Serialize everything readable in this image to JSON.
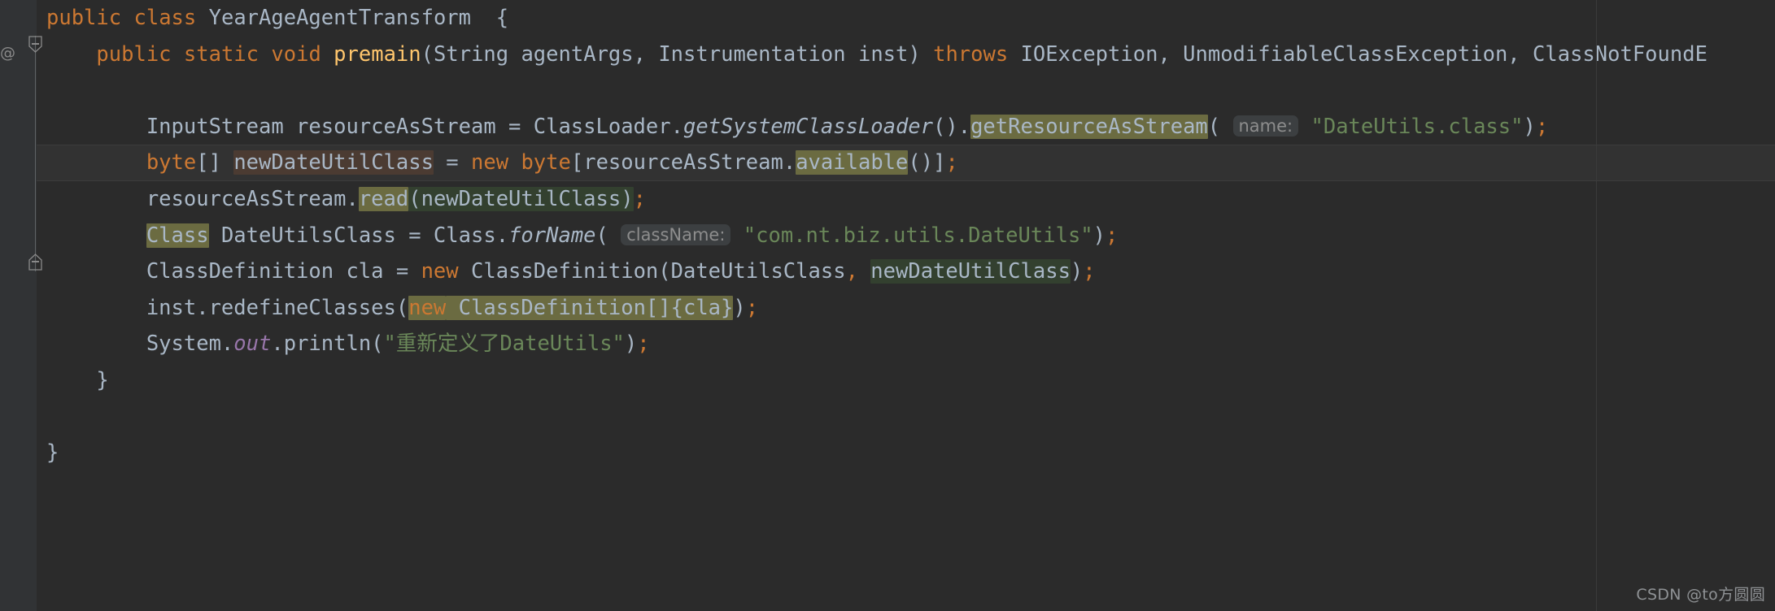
{
  "editor": {
    "background": "#2b2b2b",
    "gutter_background": "#313335",
    "caret_line_background": "#323232",
    "foreground": "#a9b7c6",
    "keyword_color": "#cc7832",
    "string_color": "#6a8759",
    "method_color": "#ffc66d",
    "static_field_color": "#9876aa",
    "highlight_olive": "#6b6b41",
    "highlight_green": "#33402f",
    "highlight_brown": "#4b3b32",
    "hint_background": "#3c3f41",
    "hint_color": "#8d8d8d"
  },
  "gutter": {
    "annotation_glyph": "@",
    "fold_open_icon": "fold-open-icon",
    "fold_close_icon": "fold-close-icon",
    "fold_minus_glyph": "−"
  },
  "code": {
    "language": "Java",
    "class_name": "YearAgeAgentTransform",
    "method_name": "premain",
    "lines": [
      {
        "id": "line-class-decl",
        "tokens": [
          {
            "t": "public",
            "k": "kw"
          },
          {
            "t": " ",
            "k": "plain"
          },
          {
            "t": "class",
            "k": "kw"
          },
          {
            "t": " ",
            "k": "plain"
          },
          {
            "t": "YearAgeAgentTransform",
            "k": "type"
          },
          {
            "t": "  {",
            "k": "plain"
          }
        ]
      },
      {
        "id": "line-premain-signature",
        "tokens": [
          {
            "t": "    ",
            "k": "plain"
          },
          {
            "t": "public",
            "k": "kw"
          },
          {
            "t": " ",
            "k": "plain"
          },
          {
            "t": "static",
            "k": "kw"
          },
          {
            "t": " ",
            "k": "plain"
          },
          {
            "t": "void",
            "k": "kw"
          },
          {
            "t": " ",
            "k": "plain"
          },
          {
            "t": "premain",
            "k": "mname"
          },
          {
            "t": "(String agentArgs, Instrumentation inst) ",
            "k": "plain"
          },
          {
            "t": "throws",
            "k": "kw"
          },
          {
            "t": " IOException, UnmodifiableClassException, ClassNotFoundE",
            "k": "plain"
          }
        ]
      },
      {
        "id": "line-blank-1",
        "tokens": []
      },
      {
        "id": "line-input-stream",
        "tokens": [
          {
            "t": "        InputStream resourceAsStream = ClassLoader.",
            "k": "plain"
          },
          {
            "t": "getSystemClassLoader",
            "k": "sitalic"
          },
          {
            "t": "().",
            "k": "plain"
          },
          {
            "t": "getResourceAsStream",
            "k": "plain",
            "hl": "olive"
          },
          {
            "t": "(",
            "k": "plain"
          },
          {
            "t": " ",
            "k": "plain"
          },
          {
            "t": "name:",
            "k": "hint"
          },
          {
            "t": " ",
            "k": "plain"
          },
          {
            "t": "\"DateUtils.class\"",
            "k": "str"
          },
          {
            "t": ")",
            "k": "plain"
          },
          {
            "t": ";",
            "k": "semi"
          }
        ]
      },
      {
        "id": "line-byte-array",
        "caret": true,
        "tokens": [
          {
            "t": "        ",
            "k": "plain"
          },
          {
            "t": "byte",
            "k": "kw"
          },
          {
            "t": "[] ",
            "k": "plain"
          },
          {
            "t": "newDateUtilClass",
            "k": "plain",
            "hl": "brown"
          },
          {
            "t": " = ",
            "k": "plain"
          },
          {
            "t": "new",
            "k": "kw"
          },
          {
            "t": " ",
            "k": "plain"
          },
          {
            "t": "byte",
            "k": "kw"
          },
          {
            "t": "[resourceAsStream.",
            "k": "plain"
          },
          {
            "t": "available",
            "k": "plain",
            "hl": "olive"
          },
          {
            "t": "()]",
            "k": "plain"
          },
          {
            "t": ";",
            "k": "semi"
          }
        ]
      },
      {
        "id": "line-read",
        "tokens": [
          {
            "t": "        resourceAsStream.",
            "k": "plain"
          },
          {
            "t": "read",
            "k": "plain",
            "hl": "olive"
          },
          {
            "t": "(newDateUtilClass)",
            "k": "plain",
            "hl": "green"
          },
          {
            "t": ";",
            "k": "semi"
          }
        ]
      },
      {
        "id": "line-for-name",
        "tokens": [
          {
            "t": "        ",
            "k": "plain"
          },
          {
            "t": "Class",
            "k": "plain",
            "hl": "olive"
          },
          {
            "t": " DateUtilsClass = Class.",
            "k": "plain"
          },
          {
            "t": "forName",
            "k": "sitalic"
          },
          {
            "t": "(",
            "k": "plain"
          },
          {
            "t": " ",
            "k": "plain"
          },
          {
            "t": "className:",
            "k": "hint"
          },
          {
            "t": " ",
            "k": "plain"
          },
          {
            "t": "\"com.nt.biz.utils.DateUtils\"",
            "k": "str"
          },
          {
            "t": ")",
            "k": "plain"
          },
          {
            "t": ";",
            "k": "semi"
          }
        ]
      },
      {
        "id": "line-class-definition",
        "tokens": [
          {
            "t": "        ClassDefinition cla = ",
            "k": "plain"
          },
          {
            "t": "new",
            "k": "kw"
          },
          {
            "t": " ClassDefinition(DateUtilsClass",
            "k": "plain"
          },
          {
            "t": ",",
            "k": "semi"
          },
          {
            "t": " ",
            "k": "plain"
          },
          {
            "t": "newDateUtilClass",
            "k": "plain",
            "hl": "green"
          },
          {
            "t": ")",
            "k": "plain"
          },
          {
            "t": ";",
            "k": "semi"
          }
        ]
      },
      {
        "id": "line-redefine-classes",
        "tokens": [
          {
            "t": "        inst.redefineClasses(",
            "k": "plain"
          },
          {
            "t": "new",
            "k": "kw",
            "hl": "olive"
          },
          {
            "t": " ClassDefinition[]{cla}",
            "k": "plain",
            "hl": "olive"
          },
          {
            "t": ")",
            "k": "plain"
          },
          {
            "t": ";",
            "k": "semi"
          }
        ]
      },
      {
        "id": "line-println",
        "tokens": [
          {
            "t": "        System.",
            "k": "plain"
          },
          {
            "t": "out",
            "k": "stat"
          },
          {
            "t": ".println(",
            "k": "plain"
          },
          {
            "t": "\"重新定义了DateUtils\"",
            "k": "str"
          },
          {
            "t": ")",
            "k": "plain"
          },
          {
            "t": ";",
            "k": "semi"
          }
        ]
      },
      {
        "id": "line-method-close",
        "tokens": [
          {
            "t": "    }",
            "k": "plain"
          }
        ]
      },
      {
        "id": "line-blank-2",
        "tokens": []
      },
      {
        "id": "line-class-close",
        "tokens": [
          {
            "t": "}",
            "k": "plain"
          }
        ]
      }
    ]
  },
  "watermark": {
    "text": "CSDN @to方圆圆"
  }
}
